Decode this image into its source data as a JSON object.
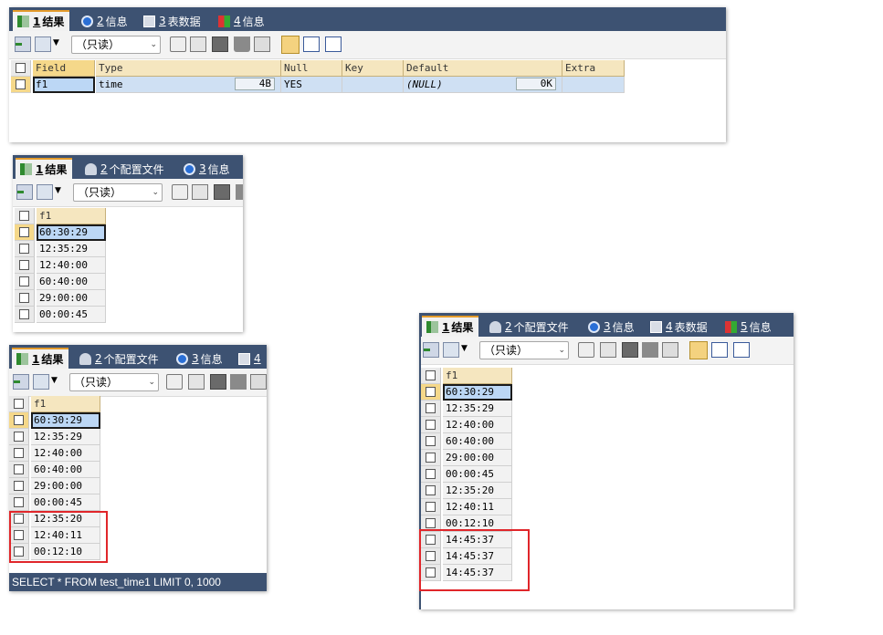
{
  "colors": {
    "tabbar": "#3d5272",
    "active_tab_accent": "#e49b2b",
    "header_bg": "#f5e6bf",
    "selected_cell": "#bcd7f5",
    "highlight_box": "#e0262a"
  },
  "panel1": {
    "tabs": [
      {
        "num": "1",
        "label": "结果",
        "icon": "grid-result-icon"
      },
      {
        "num": "2",
        "label": "信息",
        "icon": "info-icon"
      },
      {
        "num": "3",
        "label": "表数据",
        "icon": "table-icon"
      },
      {
        "num": "4",
        "label": "信息",
        "icon": "tag-icon"
      }
    ],
    "mode_select": "（只读）",
    "columns": [
      "Field",
      "Type",
      "Null",
      "Key",
      "Default",
      "Extra"
    ],
    "row": {
      "field": "f1",
      "type": "time",
      "type_size": "4B",
      "null": "YES",
      "key": "",
      "default": "(NULL)",
      "default_size": "0K",
      "extra": ""
    }
  },
  "panel2": {
    "tabs": [
      {
        "num": "1",
        "label": "结果"
      },
      {
        "num": "2",
        "label": "个配置文件"
      },
      {
        "num": "3",
        "label": "信息"
      }
    ],
    "mode_select": "（只读）",
    "column": "f1",
    "rows": [
      "60:30:29",
      "12:35:29",
      "12:40:00",
      "60:40:00",
      "29:00:00",
      "00:00:45"
    ]
  },
  "panel3": {
    "tabs": [
      {
        "num": "1",
        "label": "结果"
      },
      {
        "num": "2",
        "label": "个配置文件"
      },
      {
        "num": "3",
        "label": "信息"
      },
      {
        "num": "4",
        "label": ""
      }
    ],
    "mode_select": "（只读）",
    "column": "f1",
    "rows": [
      "60:30:29",
      "12:35:29",
      "12:40:00",
      "60:40:00",
      "29:00:00",
      "00:00:45",
      "12:35:20",
      "12:40:11",
      "00:12:10"
    ],
    "status": "SELECT * FROM test_time1 LIMIT 0, 1000"
  },
  "panel4": {
    "tabs": [
      {
        "num": "1",
        "label": "结果"
      },
      {
        "num": "2",
        "label": "个配置文件"
      },
      {
        "num": "3",
        "label": "信息"
      },
      {
        "num": "4",
        "label": "表数据"
      },
      {
        "num": "5",
        "label": "信息"
      }
    ],
    "mode_select": "（只读）",
    "column": "f1",
    "rows": [
      "60:30:29",
      "12:35:29",
      "12:40:00",
      "60:40:00",
      "29:00:00",
      "00:00:45",
      "12:35:20",
      "12:40:11",
      "00:12:10",
      "14:45:37",
      "14:45:37",
      "14:45:37"
    ]
  }
}
